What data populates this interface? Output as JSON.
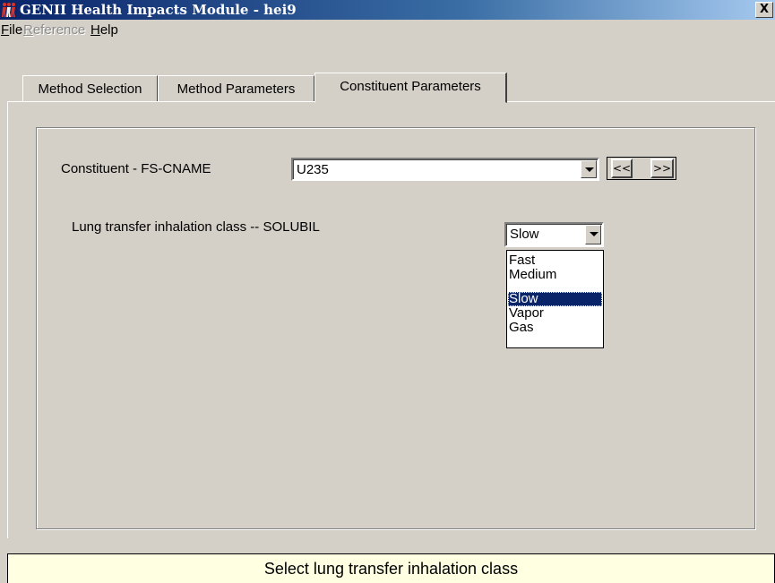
{
  "window": {
    "title": "GENII Health Impacts Module - hei9",
    "close_label": "X",
    "app_icon": "genii-figures-icon"
  },
  "menu": [
    {
      "label": "File",
      "underline": "F",
      "enabled": true
    },
    {
      "label": "Reference",
      "underline": "R",
      "enabled": false
    },
    {
      "label": "Help",
      "underline": "H",
      "enabled": true
    }
  ],
  "tabs": [
    {
      "label": "Method Selection",
      "active": false
    },
    {
      "label": "Method Parameters",
      "active": false
    },
    {
      "label": "Constituent Parameters",
      "active": true
    }
  ],
  "constituent": {
    "label": "Constituent - FS-CNAME",
    "value": "U235",
    "prev_label": "<<",
    "next_label": ">>"
  },
  "lung_class": {
    "label": "Lung transfer inhalation class -- SOLUBIL",
    "value": "Slow",
    "options": [
      "Fast",
      "Medium",
      "Slow",
      "Vapor",
      "Gas"
    ],
    "selected": "Slow"
  },
  "status": {
    "message": "Select lung transfer inhalation class"
  },
  "colors": {
    "titlebar_start": "#0a246a",
    "titlebar_end": "#a6caf0",
    "face": "#d4d0c8",
    "status_bg": "#ffffe1",
    "selection": "#0a246a"
  }
}
